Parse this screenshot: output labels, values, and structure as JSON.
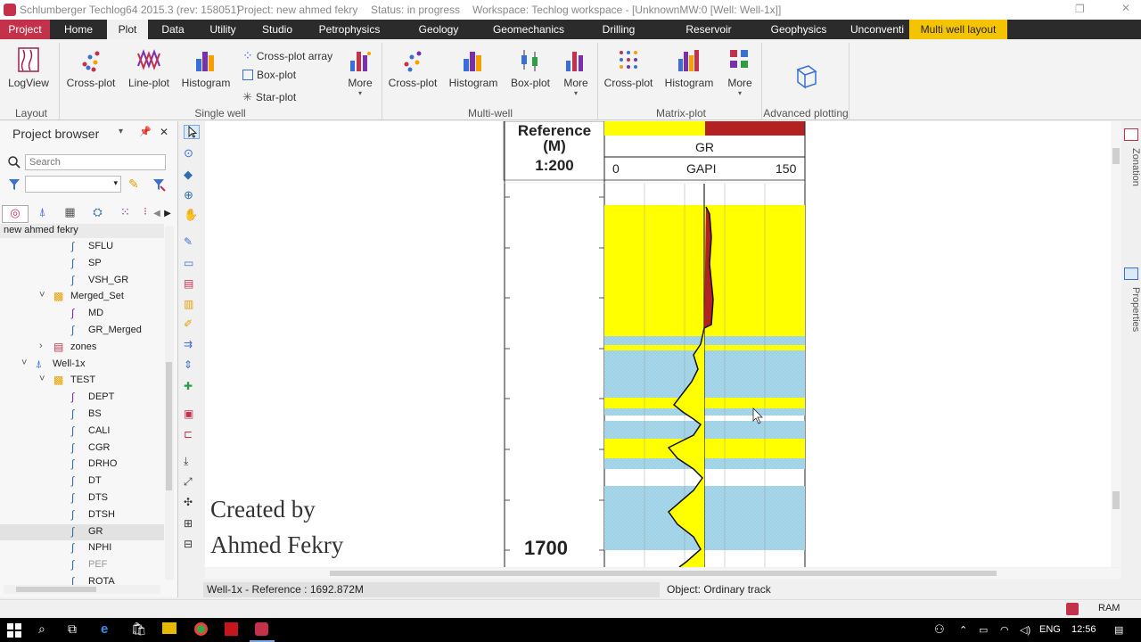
{
  "titlebar": {
    "app": "Schlumberger Techlog64 2015.3 (rev: 158051)",
    "project": "Project: new ahmed fekry",
    "status": "Status: in progress",
    "workspace": "Workspace: Techlog workspace - [UnknownMW:0 [Well: Well-1x]]"
  },
  "menu": {
    "tabs": [
      "Project",
      "Home",
      "Plot",
      "Data",
      "Utility",
      "Studio",
      "Petrophysics",
      "Geology",
      "Geomechanics",
      "Drilling",
      "Reservoir",
      "Geophysics",
      "Unconventi",
      "Multi well layout"
    ],
    "active": "Plot"
  },
  "ribbon": {
    "layout": {
      "logview": "LogView",
      "group": "Layout"
    },
    "single_well": {
      "crossplot": "Cross-plot",
      "lineplot": "Line-plot",
      "histogram": "Histogram",
      "crossplot_array": "Cross-plot array",
      "boxplot": "Box-plot",
      "starplot": "Star-plot",
      "more": "More",
      "group": "Single well"
    },
    "multi_well": {
      "crossplot": "Cross-plot",
      "histogram": "Histogram",
      "boxplot": "Box-plot",
      "more": "More",
      "group": "Multi-well"
    },
    "matrix_plot": {
      "crossplot": "Cross-plot",
      "histogram": "Histogram",
      "more": "More",
      "group": "Matrix-plot"
    },
    "advanced": {
      "group": "Advanced plotting"
    }
  },
  "browser": {
    "title": "Project browser",
    "search_placeholder": "Search",
    "root": "new ahmed fekry",
    "items": [
      {
        "label": "SFLU",
        "kind": "curve"
      },
      {
        "label": "SP",
        "kind": "curve"
      },
      {
        "label": "VSH_GR",
        "kind": "curve"
      },
      {
        "label": "Merged_Set",
        "kind": "set"
      },
      {
        "label": "MD",
        "kind": "curve-purple"
      },
      {
        "label": "GR_Merged",
        "kind": "curve"
      },
      {
        "label": "zones",
        "kind": "zones"
      },
      {
        "label": "Well-1x",
        "kind": "well"
      },
      {
        "label": "TEST",
        "kind": "set"
      },
      {
        "label": "DEPT",
        "kind": "curve-purple"
      },
      {
        "label": "BS",
        "kind": "curve"
      },
      {
        "label": "CALI",
        "kind": "curve"
      },
      {
        "label": "CGR",
        "kind": "curve"
      },
      {
        "label": "DRHO",
        "kind": "curve"
      },
      {
        "label": "DT",
        "kind": "curve"
      },
      {
        "label": "DTS",
        "kind": "curve"
      },
      {
        "label": "DTSH",
        "kind": "curve"
      },
      {
        "label": "GR",
        "kind": "curve"
      },
      {
        "label": "NPHI",
        "kind": "curve"
      },
      {
        "label": "PEF",
        "kind": "curve"
      },
      {
        "label": "ROTA",
        "kind": "curve"
      }
    ],
    "selected": "GR"
  },
  "plot": {
    "reference_title": "Reference",
    "reference_unit": "(M)",
    "scale": "1:200",
    "depth_label": "1700",
    "track_name": "GR",
    "track_min": "0",
    "track_unit": "GAPI",
    "track_max": "150",
    "watermark_line1": "Created by",
    "watermark_line2": "Ahmed Fekry",
    "side_tab_top": "Zonation",
    "side_tab_bottom": "Properties",
    "colors": {
      "sand": "#ffff00",
      "shale": "#a7d7ea",
      "header_red": "#b22222"
    }
  },
  "status": {
    "left": "Well-1x - Reference : 1692.872M",
    "right": "Object: Ordinary track"
  },
  "taskbar": {
    "lang": "ENG",
    "time": "12:56",
    "ram": "RAM"
  }
}
